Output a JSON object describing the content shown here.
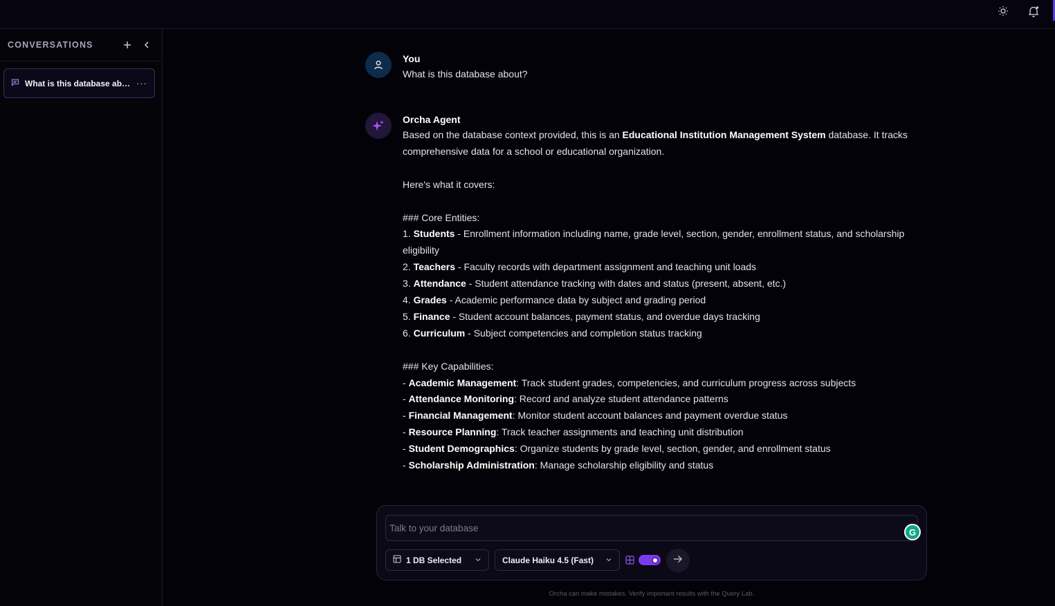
{
  "sidebar": {
    "title": "CONVERSATIONS",
    "conversations": [
      {
        "label": "What is this database abo..."
      }
    ]
  },
  "messages": {
    "user": {
      "sender": "You",
      "text": "What is this database about?"
    },
    "agent": {
      "sender": "Orcha Agent",
      "intro_pre": "Based on the database context provided, this is an ",
      "intro_bold": "Educational Institution Management System",
      "intro_post": " database. It tracks comprehensive data for a school or educational organization.",
      "covers": "Here's what it covers:",
      "core_heading": "### Core Entities:",
      "core_entities": [
        {
          "prefix": "1. ",
          "name": "Students",
          "desc": " - Enrollment information including name, grade level, section, gender, enrollment status, and scholarship eligibility"
        },
        {
          "prefix": "2. ",
          "name": "Teachers",
          "desc": " - Faculty records with department assignment and teaching unit loads"
        },
        {
          "prefix": "3. ",
          "name": "Attendance",
          "desc": " - Student attendance tracking with dates and status (present, absent, etc.)"
        },
        {
          "prefix": "4. ",
          "name": "Grades",
          "desc": " - Academic performance data by subject and grading period"
        },
        {
          "prefix": "5. ",
          "name": "Finance",
          "desc": " - Student account balances, payment status, and overdue days tracking"
        },
        {
          "prefix": "6. ",
          "name": "Curriculum",
          "desc": " - Subject competencies and completion status tracking"
        }
      ],
      "cap_heading": "### Key Capabilities:",
      "capabilities": [
        {
          "prefix": "- ",
          "name": "Academic Management",
          "desc": ": Track student grades, competencies, and curriculum progress across subjects"
        },
        {
          "prefix": "- ",
          "name": "Attendance Monitoring",
          "desc": ": Record and analyze student attendance patterns"
        },
        {
          "prefix": "- ",
          "name": "Financial Management",
          "desc": ": Monitor student account balances and payment overdue status"
        },
        {
          "prefix": "- ",
          "name": "Resource Planning",
          "desc": ": Track teacher assignments and teaching unit distribution"
        },
        {
          "prefix": "- ",
          "name": "Student Demographics",
          "desc": ": Organize students by grade level, section, gender, and enrollment status"
        },
        {
          "prefix": "- ",
          "name": "Scholarship Administration",
          "desc": ": Manage scholarship eligibility and status"
        }
      ]
    }
  },
  "composer": {
    "placeholder": "Talk to your database",
    "db_select": "1 DB Selected",
    "model_select": "Claude Haiku 4.5 (Fast)",
    "toggle_on": true
  },
  "footer_note": "Orcha can make mistakes. Verify important results with the Query Lab.",
  "colors": {
    "accent": "#7c3aed",
    "background": "#030208"
  },
  "icons": {
    "theme": "sun-icon",
    "notifications": "bell-icon",
    "new_conversation": "plus-icon",
    "collapse_sidebar": "chevron-left-icon",
    "conversation": "message-icon",
    "user_avatar": "user-icon",
    "agent_avatar": "sparkles-icon",
    "db": "table-icon",
    "send": "arrow-right-icon"
  }
}
